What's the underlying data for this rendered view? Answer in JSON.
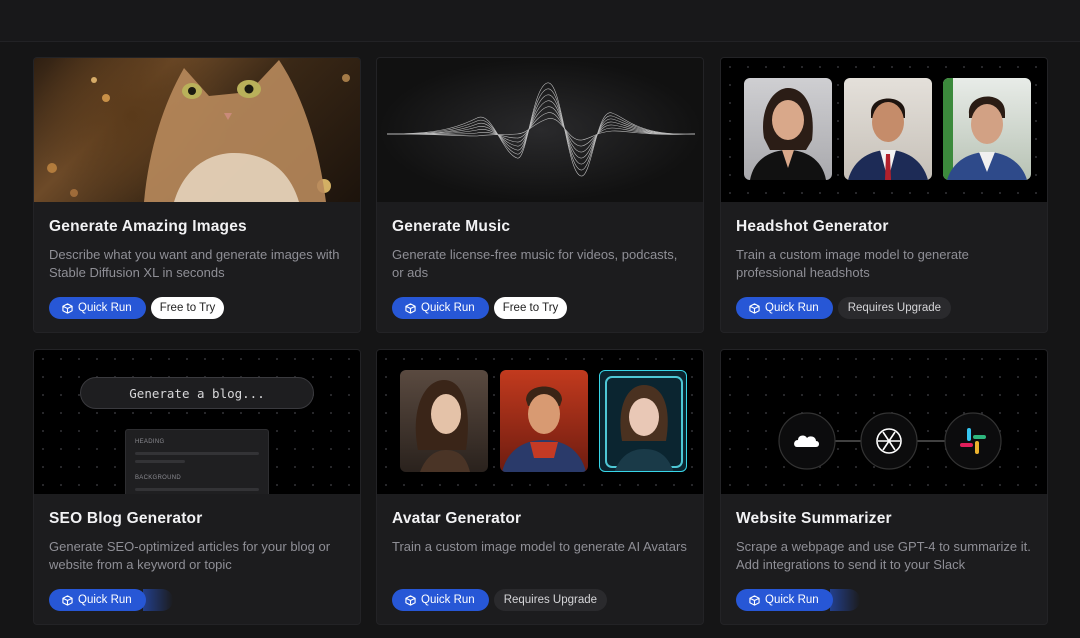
{
  "cards": [
    {
      "title": "Generate Amazing Images",
      "desc": "Describe what you want and generate images with Stable Diffusion XL in seconds",
      "run": "Quick Run",
      "tag": "Free to Try"
    },
    {
      "title": "Generate Music",
      "desc": "Generate license-free music for videos, podcasts, or ads",
      "run": "Quick Run",
      "tag": "Free to Try"
    },
    {
      "title": "Headshot Generator",
      "desc": "Train a custom image model to generate professional headshots",
      "run": "Quick Run",
      "tag": "Requires Upgrade"
    },
    {
      "title": "SEO Blog Generator",
      "desc": "Generate SEO-optimized articles for your blog or website from a keyword or topic",
      "run": "Quick Run",
      "tag": ""
    },
    {
      "title": "Avatar Generator",
      "desc": "Train a custom image model to generate AI Avatars",
      "run": "Quick Run",
      "tag": "Requires Upgrade"
    },
    {
      "title": "Website Summarizer",
      "desc": "Scrape a webpage and use GPT-4 to summarize it. Add integrations to send it to your Slack",
      "run": "Quick Run",
      "tag": ""
    }
  ],
  "seo_preview": {
    "input": "Generate a blog...",
    "heading": "HEADING",
    "background": "BACKGROUND"
  },
  "icons": {
    "run": "cube-icon",
    "cloud": "cloud-icon",
    "openai": "openai-icon",
    "slack": "slack-icon"
  },
  "colors": {
    "accent": "#2757d6",
    "background": "#151516",
    "card": "#1c1c1e"
  }
}
